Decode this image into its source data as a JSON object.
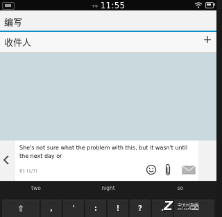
{
  "status_bar": {
    "ampm": "下午",
    "time": "11:55"
  },
  "header": {
    "title": "编写"
  },
  "recipient": {
    "label": "收件人",
    "add_icon": "plus-icon"
  },
  "compose": {
    "message": "She's not sure what the problem with this, but it wasn't until the next day or",
    "char_count": "81 (1/7)",
    "icons": [
      "emoji-icon",
      "attachment-icon",
      "send-icon"
    ]
  },
  "keyboard": {
    "suggestions": [
      "two",
      "night",
      "so"
    ],
    "keys": {
      "shift": "⇧",
      "comma": ",",
      "apostrophe": "'",
      "colon": ":",
      "exclamation": "!",
      "question": "?",
      "period": ".",
      "backspace": "⌫"
    }
  },
  "watermark": {
    "mark": "Z",
    "text": "中关村在线",
    "url": "zol.com.cn"
  },
  "colors": {
    "accent": "#0c8ec9",
    "body_bg": "#c9d9dd",
    "keyboard_bg": "#1c1c1c"
  }
}
